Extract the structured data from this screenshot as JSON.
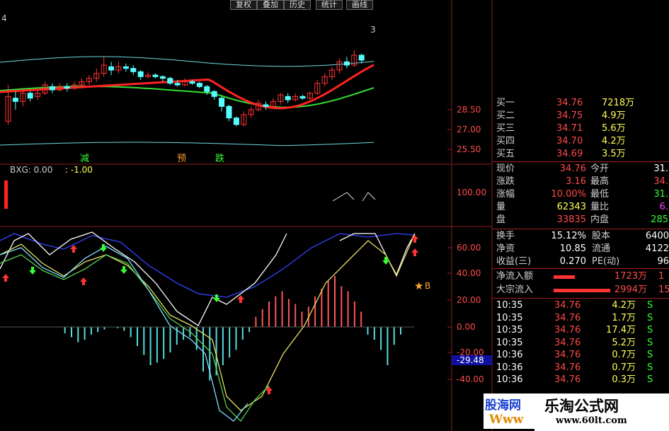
{
  "toolbar": {
    "buttons": [
      "复权",
      "叠加",
      "历史",
      "统计",
      "画线"
    ]
  },
  "main_chart": {
    "top_right_label": "3",
    "top_left_label": "4",
    "y_ticks": [
      "28.50",
      "27.00",
      "25.50"
    ],
    "markers": [
      {
        "text": "减",
        "color": "#33ff33"
      },
      {
        "text": "预",
        "color": "#ff9933"
      },
      {
        "text": "跌",
        "color": "#33ff33"
      }
    ]
  },
  "bxg": {
    "title": "BXG: 0.00",
    "value": ": -1.00",
    "y_tick": "100.00"
  },
  "indicator": {
    "y_ticks": [
      "60.00",
      "40.00",
      "20.00",
      "0.00",
      "-20.00",
      "-40.00"
    ],
    "current_value": "-29.48",
    "b_label": "B"
  },
  "quote": {
    "bids": [
      {
        "label": "买一",
        "price": "34.76",
        "vol": "7218万"
      },
      {
        "label": "买二",
        "price": "34.75",
        "vol": "4.9万"
      },
      {
        "label": "买三",
        "price": "34.71",
        "vol": "5.6万"
      },
      {
        "label": "买四",
        "price": "34.70",
        "vol": "4.2万"
      },
      {
        "label": "买五",
        "price": "34.69",
        "vol": "3.5万"
      }
    ],
    "stats": [
      {
        "l1": "现价",
        "v1": "34.76",
        "l2": "今开",
        "v2": "31.",
        "c1": "red",
        "c2": "wht"
      },
      {
        "l1": "涨跌",
        "v1": "3.16",
        "l2": "最高",
        "v2": "34.",
        "c1": "red",
        "c2": "red"
      },
      {
        "l1": "涨幅",
        "v1": "10.00%",
        "l2": "最低",
        "v2": "31.",
        "c1": "red",
        "c2": "grn"
      },
      {
        "l1": "量",
        "v1": "62343",
        "l2": "量比",
        "v2": "6.",
        "c1": "yel",
        "c2": "mag"
      },
      {
        "l1": "盘",
        "v1": "33835",
        "l2": "内盘",
        "v2": "285",
        "c1": "red",
        "c2": "grn"
      }
    ],
    "stats2": [
      {
        "l1": "换手",
        "v1": "15.12%",
        "l2": "股本",
        "v2": "6400"
      },
      {
        "l1": "净资",
        "v1": "10.85",
        "l2": "流通",
        "v2": "4122"
      },
      {
        "l1": "收益(三)",
        "v1": "0.270",
        "l2": "PE(动)",
        "v2": "96"
      }
    ],
    "flows": [
      {
        "label": "净流入额",
        "value": "1723万",
        "extra": "1"
      },
      {
        "label": "大宗流入",
        "value": "2994万",
        "extra": "15"
      }
    ],
    "ticks": [
      {
        "t": "10:35",
        "p": "34.76",
        "v": "4.2万",
        "s": "S"
      },
      {
        "t": "10:35",
        "p": "34.76",
        "v": "1.7万",
        "s": "S"
      },
      {
        "t": "10:35",
        "p": "34.76",
        "v": "17.4万",
        "s": "S"
      },
      {
        "t": "10:35",
        "p": "34.76",
        "v": "5.2万",
        "s": "S"
      },
      {
        "t": "10:36",
        "p": "34.76",
        "v": "0.7万",
        "s": "S"
      },
      {
        "t": "10:36",
        "p": "34.76",
        "v": "0.7万",
        "s": "S"
      },
      {
        "t": "10:36",
        "p": "34.76",
        "v": "0.3万",
        "s": "S"
      }
    ]
  },
  "watermark": {
    "left_text": "股海网",
    "left_sub": "Www",
    "right_text": "乐淘公式网",
    "right_url": "www.60lt.com"
  },
  "chart_data": {
    "type": "candlestick",
    "ylim": [
      25.5,
      31.5
    ],
    "candles": [
      [
        27.2,
        28.7,
        27.0,
        29.4
      ],
      [
        28.6,
        28.4,
        27.9,
        29.0
      ],
      [
        28.4,
        28.9,
        28.1,
        29.1
      ],
      [
        28.9,
        28.6,
        28.4,
        29.0
      ],
      [
        28.7,
        28.9,
        28.5,
        29.1
      ],
      [
        28.9,
        29.4,
        28.8,
        29.6
      ],
      [
        29.3,
        29.1,
        28.9,
        29.5
      ],
      [
        29.1,
        29.3,
        29.0,
        29.5
      ],
      [
        29.3,
        29.2,
        29.0,
        29.5
      ],
      [
        29.2,
        29.4,
        29.1,
        29.6
      ],
      [
        29.4,
        29.6,
        29.3,
        29.8
      ],
      [
        29.6,
        29.8,
        29.4,
        30.0
      ],
      [
        29.8,
        30.1,
        29.6,
        30.4
      ],
      [
        30.1,
        30.6,
        29.9,
        31.1
      ],
      [
        30.5,
        30.3,
        30.0,
        30.8
      ],
      [
        30.3,
        30.5,
        30.1,
        30.8
      ],
      [
        30.5,
        30.4,
        30.2,
        30.7
      ],
      [
        30.4,
        30.2,
        30.0,
        30.6
      ],
      [
        30.2,
        29.9,
        29.7,
        30.3
      ],
      [
        29.9,
        30.0,
        29.8,
        30.2
      ],
      [
        30.0,
        29.9,
        29.8,
        30.1
      ],
      [
        29.9,
        29.8,
        29.6,
        30.0
      ],
      [
        29.8,
        29.5,
        29.4,
        29.9
      ],
      [
        29.5,
        29.4,
        29.3,
        29.7
      ],
      [
        29.4,
        29.6,
        29.3,
        29.8
      ],
      [
        29.6,
        29.5,
        29.4,
        29.7
      ],
      [
        29.5,
        29.3,
        29.2,
        29.6
      ],
      [
        29.3,
        29.0,
        28.8,
        29.4
      ],
      [
        29.0,
        28.7,
        28.5,
        29.1
      ],
      [
        28.6,
        28.1,
        27.8,
        28.7
      ],
      [
        28.1,
        27.4,
        27.2,
        28.2
      ],
      [
        27.4,
        27.0,
        26.9,
        27.5
      ],
      [
        27.0,
        27.6,
        26.9,
        27.8
      ],
      [
        27.6,
        27.9,
        27.4,
        28.1
      ],
      [
        27.9,
        28.3,
        27.8,
        28.5
      ],
      [
        28.2,
        28.1,
        27.9,
        28.4
      ],
      [
        28.1,
        28.4,
        28.0,
        28.6
      ],
      [
        28.4,
        28.8,
        28.2,
        28.9
      ],
      [
        28.7,
        28.5,
        28.3,
        28.9
      ],
      [
        28.5,
        28.7,
        28.4,
        28.9
      ],
      [
        28.7,
        28.6,
        28.5,
        28.8
      ],
      [
        28.6,
        28.9,
        28.5,
        29.0
      ],
      [
        28.9,
        29.5,
        28.8,
        29.7
      ],
      [
        29.5,
        29.9,
        29.3,
        30.1
      ],
      [
        29.9,
        30.3,
        29.7,
        30.5
      ],
      [
        30.3,
        30.8,
        30.1,
        31.0
      ],
      [
        30.8,
        30.6,
        30.4,
        31.1
      ],
      [
        30.6,
        31.2,
        30.5,
        31.5
      ],
      [
        31.2,
        30.9,
        30.7,
        31.3
      ]
    ],
    "histogram": [
      0,
      0,
      0,
      0,
      0,
      0,
      0,
      0,
      0,
      -5,
      -8,
      -12,
      -10,
      -6,
      -4,
      -2,
      0,
      -1,
      -3,
      -8,
      -15,
      -22,
      -30,
      -28,
      -25,
      -20,
      -14,
      -10,
      -8,
      -18,
      -35,
      -42,
      -38,
      -30,
      -24,
      -18,
      -10,
      -4,
      8,
      14,
      20,
      24,
      28,
      22,
      18,
      12,
      16,
      24,
      30,
      36,
      40,
      32,
      28,
      20,
      12,
      -6,
      -10,
      -18,
      -30,
      -14,
      -6
    ]
  }
}
